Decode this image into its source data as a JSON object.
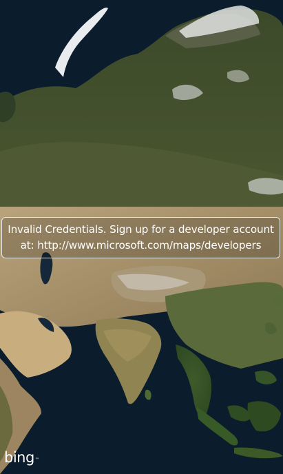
{
  "map": {
    "imagery": "aerial",
    "region_depicted": "Asia"
  },
  "banner": {
    "line1": "Invalid Credentials. Sign up for a developer account",
    "line2": "at: http://www.microsoft.com/maps/developers"
  },
  "branding": {
    "logo_text": "bing",
    "trademark": "™"
  },
  "colors": {
    "ocean": "#0b1c2c",
    "banner_border": "#e8ece8",
    "banner_text": "#ffffff"
  }
}
